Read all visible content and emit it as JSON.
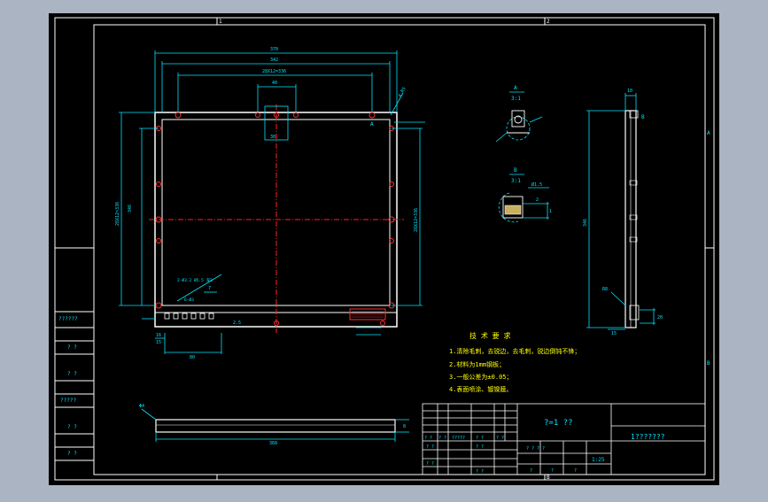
{
  "colors": {
    "outer_bg": "#aab4c2",
    "drawing_bg": "#000000",
    "frame": "#ffffff",
    "dims": "#00e5ff",
    "notes_text": "#ffff00",
    "centerline": "#ff2020",
    "holes": "#ff3030",
    "parts": "#ffffff"
  },
  "zones": {
    "top_left": "1",
    "top_right": "2",
    "bottom_right": "B",
    "side_right_top": "A",
    "side_right_bottom": "B"
  },
  "main_view": {
    "dim_outer_width": "370",
    "dim_inner_width": "342",
    "dim_hole_span": "28X12=336",
    "dim_small": "40",
    "dim_slot": "30",
    "dim_left_outer": "346",
    "dim_left_total": "28X12=336",
    "dim_right_total": "28X12=336",
    "dim_corner": "4-R5",
    "section_label_a": "A",
    "bottom_dim_1": "16",
    "bottom_dim_2": "15",
    "bottom_dim_3": "80",
    "bottom_dim_4": "7",
    "bottom_dim_5": "2.5",
    "note_leader": "2-Ø3.2 Ø5.5 深3",
    "note_leader_2": "6-Ø3"
  },
  "section_a": {
    "letter": "A",
    "scale": "3:1"
  },
  "section_b": {
    "letter": "B",
    "scale": "3:1",
    "dim_1": "Ø1.5",
    "dim_2": "2",
    "dim_3": "1"
  },
  "side_view": {
    "dim_top": "10",
    "dim_height": "346",
    "dim_b1": "R8",
    "dim_b2": "20",
    "dim_b3": "15",
    "label_b": "B"
  },
  "bottom_view": {
    "dim_width": "368",
    "dim_left": "Φ4",
    "dim_right": "8"
  },
  "tech_notes": {
    "title": "技 术 要 求",
    "lines": [
      "1.清除毛刺，去锐边，去毛刺，锐边倒钝不锋；",
      "2.材料为1mm钢板；",
      "3.一般公差为±0.05；",
      "4.表面喷涂、镀镍膜。"
    ]
  },
  "left_strip": {
    "labels": [
      "??????",
      "? ?",
      "? ?",
      "?????",
      "? ?",
      "? ?"
    ]
  },
  "title_block": {
    "scale_text": "?=1 ??",
    "drawing_no": "1???????",
    "row_a": [
      "? ?",
      "? ?",
      "?????",
      "? ?",
      "? ?"
    ],
    "row_b": [
      "? ?",
      "? ?"
    ],
    "row_c": [
      "? ?",
      "? ?"
    ],
    "cell_mid": "? ? ? ?",
    "cell_qty": "1:25",
    "cell_bottom": [
      "?",
      "?",
      "?"
    ]
  }
}
